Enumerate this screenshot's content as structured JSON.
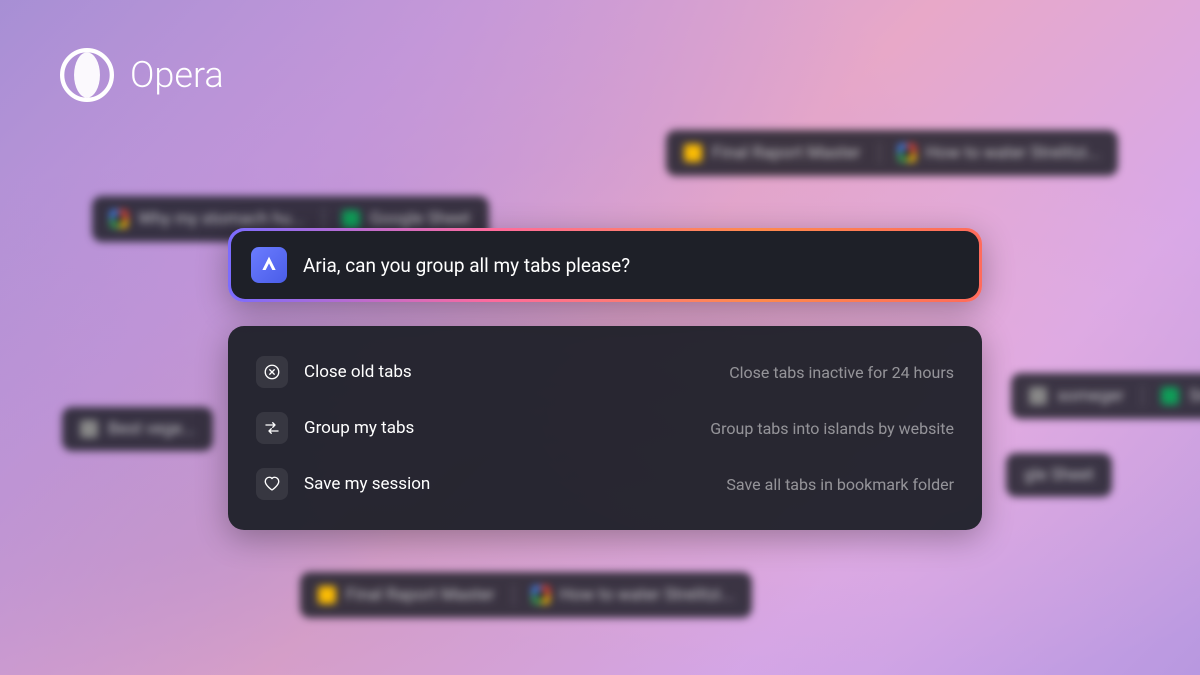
{
  "brand": {
    "name": "Opera"
  },
  "command": {
    "text": "Aria, can you group all my tabs please?"
  },
  "suggestions": [
    {
      "label": "Close old tabs",
      "description": "Close tabs inactive for 24 hours"
    },
    {
      "label": "Group my tabs",
      "description": "Group tabs into islands by website"
    },
    {
      "label": "Save my session",
      "description": "Save all tabs in bookmark folder"
    }
  ],
  "background_tabs": {
    "tab1_a": "Why my stomach hu...",
    "tab1_b": "Google Sheet",
    "tab2_a": "Final Raport Master",
    "tab2_b": "How to water Strelitzi...",
    "tab3": "Best vege...",
    "tab4_a": "someger",
    "tab4_b": "Sn...",
    "tab5": "gle Sheet",
    "tab6_a": "Final Raport Master",
    "tab6_b": "How to water Strelitzi..."
  }
}
